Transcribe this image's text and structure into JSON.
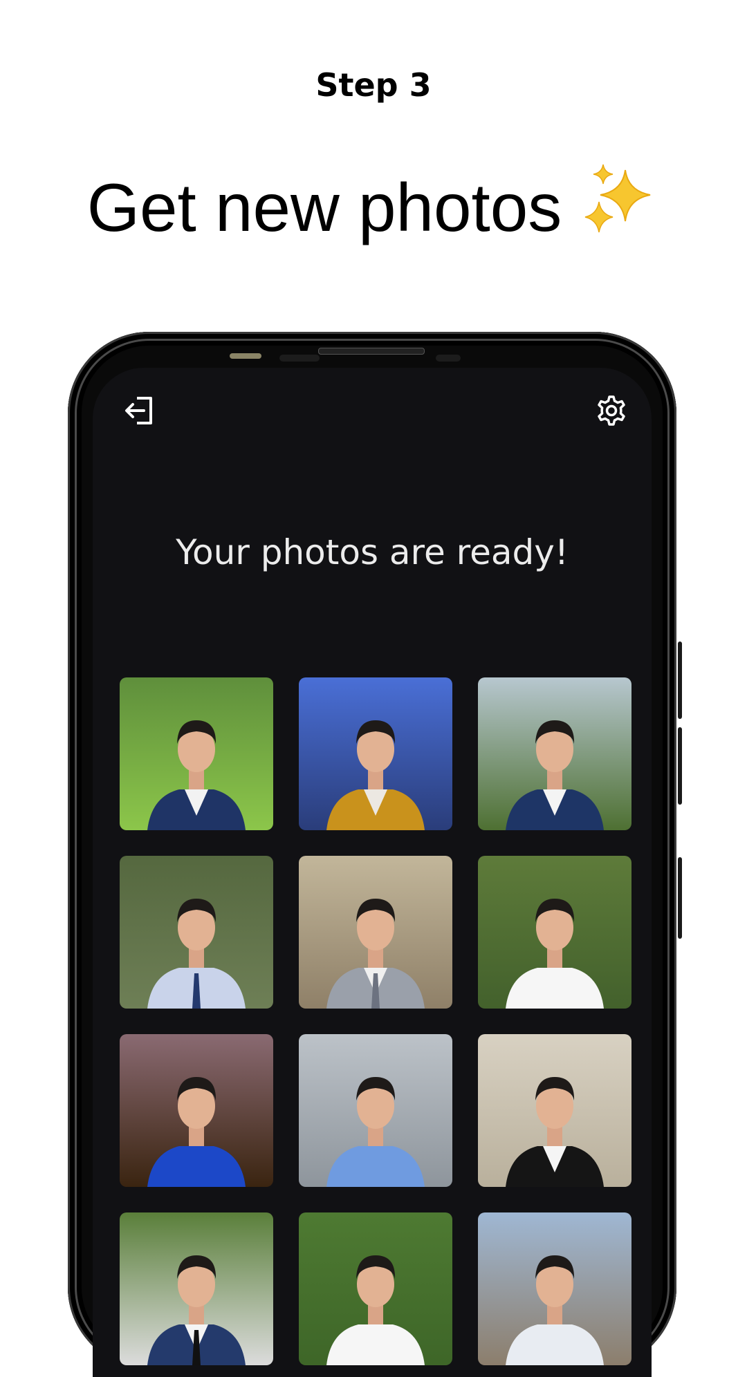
{
  "header": {
    "step": "Step 3",
    "headline": "Get new photos",
    "headline_icon": "sparkles-icon"
  },
  "app": {
    "logout_icon": "logout-icon",
    "settings_icon": "settings-gear-icon",
    "title": "Your photos are ready!"
  },
  "photos": [
    {
      "scene": "park lawn",
      "bg_top": "#5f8f3c",
      "bg_bottom": "#8cc64a",
      "outfit": "#1f3466",
      "shirt": "#f2f2f2",
      "tie": ""
    },
    {
      "scene": "city lights",
      "bg_top": "#4a6fd6",
      "bg_bottom": "#2a3d7a",
      "outfit": "#c9921c",
      "shirt": "#ece8e2",
      "tie": ""
    },
    {
      "scene": "trees",
      "bg_top": "#b7c7cf",
      "bg_bottom": "#4e7032",
      "outfit": "#1e3566",
      "shirt": "#f4f4f4",
      "tie": ""
    },
    {
      "scene": "forest",
      "bg_top": "#55683f",
      "bg_bottom": "#6e7f56",
      "outfit": "#c9d3ea",
      "shirt": "#c9d3ea",
      "tie": "#23396e"
    },
    {
      "scene": "columns",
      "bg_top": "#c2b69a",
      "bg_bottom": "#8f8068",
      "outfit": "#9aa0aa",
      "shirt": "#f0f0f0",
      "tie": "#6c7280"
    },
    {
      "scene": "foliage",
      "bg_top": "#5e7b3a",
      "bg_bottom": "#43612c",
      "outfit": "#f6f6f6",
      "shirt": "#f6f6f6",
      "tie": ""
    },
    {
      "scene": "night city",
      "bg_top": "#8a6a72",
      "bg_bottom": "#3a2410",
      "outfit": "#1c48c8",
      "shirt": "#1c48c8",
      "tie": ""
    },
    {
      "scene": "stone wall",
      "bg_top": "#bcc2c8",
      "bg_bottom": "#8e959c",
      "outfit": "#6f9be0",
      "shirt": "#6f9be0",
      "tie": ""
    },
    {
      "scene": "rock wall",
      "bg_top": "#d8d1c2",
      "bg_bottom": "#b9b09c",
      "outfit": "#151515",
      "shirt": "#f5f5f5",
      "tie": ""
    },
    {
      "scene": "garden fence",
      "bg_top": "#5a7f3a",
      "bg_bottom": "#dcdcdc",
      "outfit": "#243a6c",
      "shirt": "#f4f4f4",
      "tie": "#111111"
    },
    {
      "scene": "trees",
      "bg_top": "#4e7a32",
      "bg_bottom": "#3e6628",
      "outfit": "#f6f6f6",
      "shirt": "#f6f6f6",
      "tie": ""
    },
    {
      "scene": "sea city",
      "bg_top": "#9fb7d3",
      "bg_bottom": "#8c7e6c",
      "outfit": "#e8ecf2",
      "shirt": "#e8ecf2",
      "tie": ""
    }
  ],
  "colors": {
    "screen_bg": "#111114",
    "phone_frame": "#0a0a0a",
    "title_text": "#ececec"
  }
}
